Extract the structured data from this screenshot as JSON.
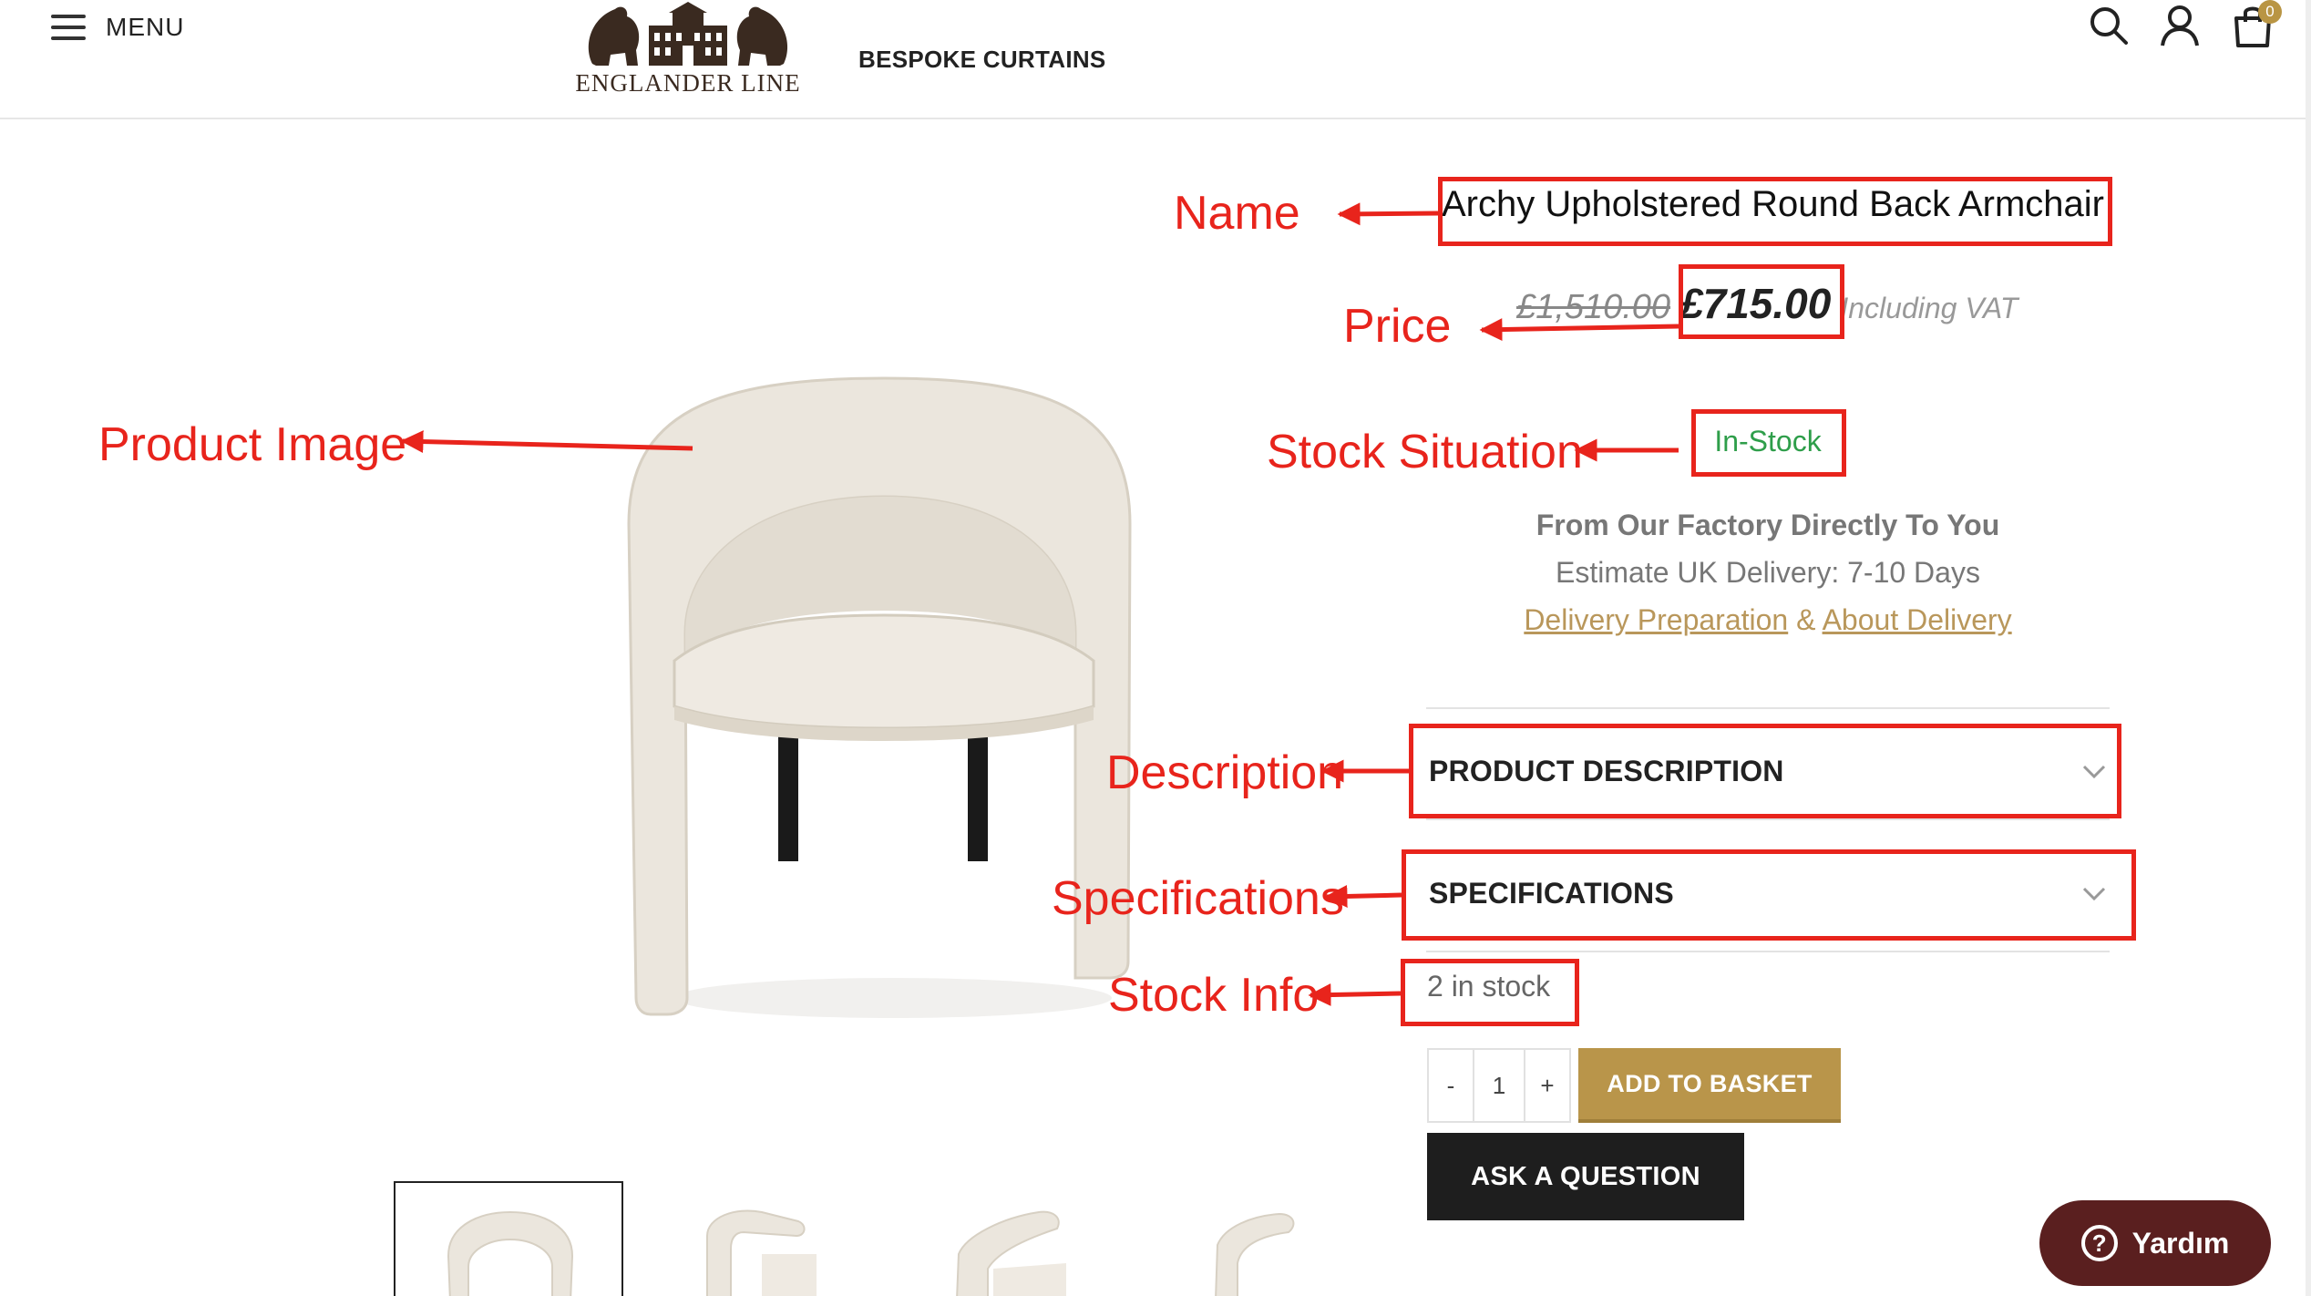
{
  "header": {
    "menu_label": "MENU",
    "logo_text": "ENGLANDER LINE",
    "nav_link": "BESPOKE CURTAINS",
    "icons": [
      "search-icon",
      "account-icon",
      "cart-icon"
    ],
    "cart_count": "0"
  },
  "product": {
    "name": "Archy Upholstered Round Back Armchair",
    "old_price": "£1,510.00",
    "price": "£715.00",
    "vat_note": "Including VAT",
    "stock_status": "In-Stock",
    "factory_line": "From Our Factory Directly To You",
    "estimate_line": "Estimate UK Delivery: 7-10 Days",
    "delivery_prep_link": "Delivery Preparation",
    "links_separator": "&",
    "about_delivery_link": "About Delivery",
    "description_label": "PRODUCT DESCRIPTION",
    "specifications_label": "SPECIFICATIONS",
    "stock_info": "2 in stock",
    "quantity": {
      "minus": "-",
      "value": "1",
      "plus": "+"
    },
    "add_to_basket": "ADD TO BASKET",
    "ask_question": "ASK A QUESTION"
  },
  "help": {
    "label": "Yardım",
    "icon_glyph": "?"
  },
  "annotations": {
    "name": "Name",
    "price": "Price",
    "product_image": "Product Image",
    "stock_situation": "Stock Situation",
    "description": "Description",
    "specifications": "Specifications",
    "stock_info": "Stock Info",
    "color": "#e8241c"
  },
  "colors": {
    "accent_gold": "#b9954a",
    "stock_green": "#2e9e4a",
    "link_gold": "#b9975b",
    "help_bg": "#5a1f1f",
    "ask_bg": "#1e1e1e"
  }
}
